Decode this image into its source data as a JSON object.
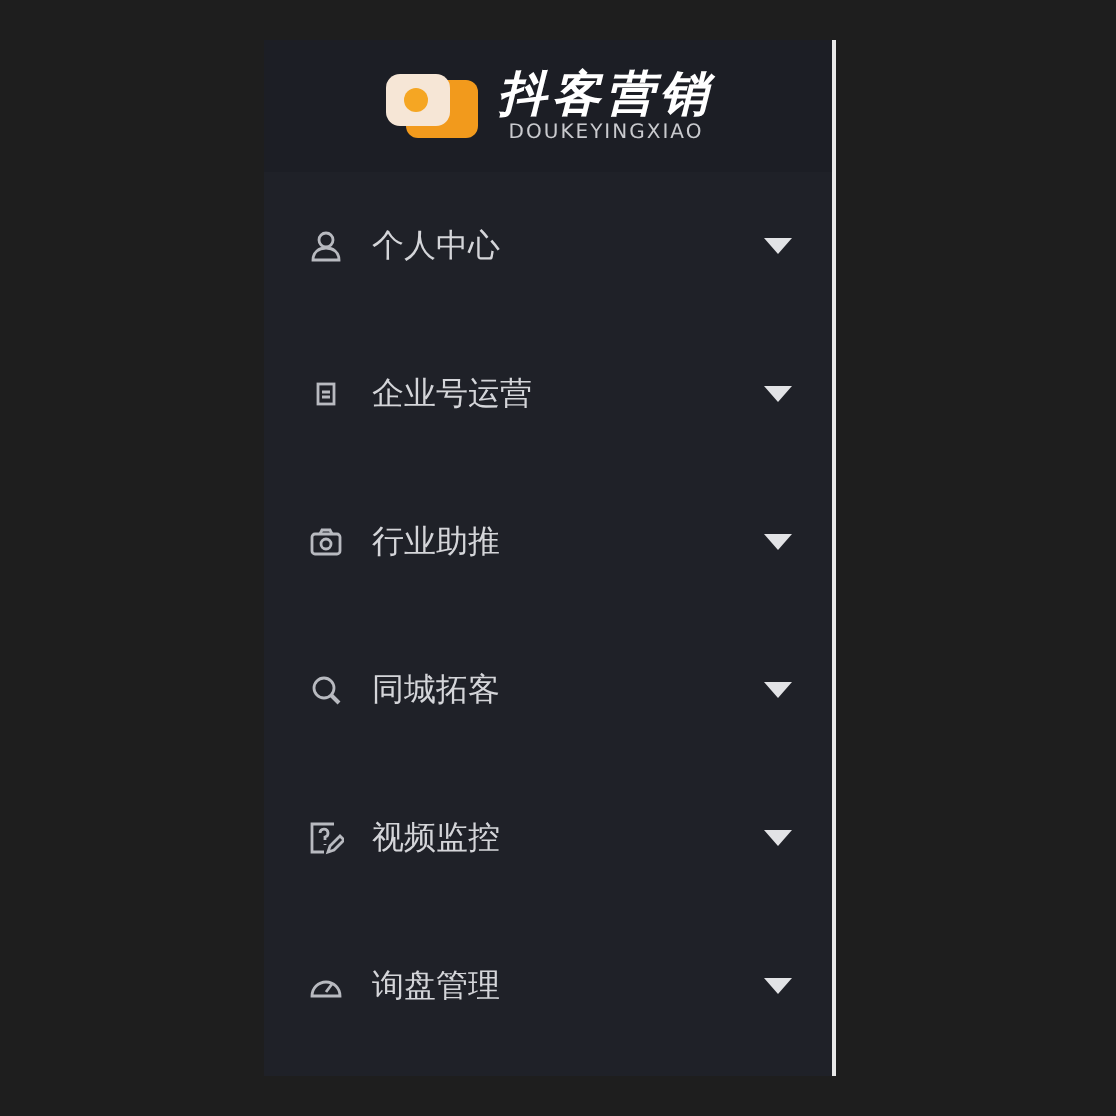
{
  "logo": {
    "name": "抖客营销",
    "subtitle": "DOUKEYINGXIAO"
  },
  "menu": [
    {
      "label": "个人中心"
    },
    {
      "label": "企业号运营"
    },
    {
      "label": "行业助推"
    },
    {
      "label": "同城拓客"
    },
    {
      "label": "视频监控"
    },
    {
      "label": "询盘管理"
    }
  ]
}
